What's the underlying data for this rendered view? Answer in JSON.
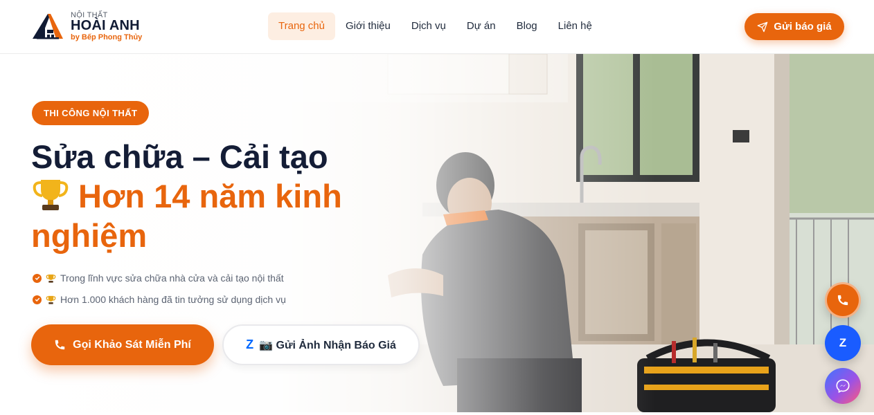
{
  "header": {
    "logo": {
      "small": "NỘI THẤT",
      "main": "HOÀI ANH",
      "sub": "by Bếp Phong Thủy"
    },
    "nav": [
      {
        "label": "Trang chủ",
        "active": true
      },
      {
        "label": "Giới thiệu",
        "active": false
      },
      {
        "label": "Dịch vụ",
        "active": false
      },
      {
        "label": "Dự án",
        "active": false
      },
      {
        "label": "Blog",
        "active": false
      },
      {
        "label": "Liên hệ",
        "active": false
      }
    ],
    "quote_button": {
      "label": "Gửi báo giá",
      "icon": "send-icon"
    }
  },
  "hero": {
    "badge": "THI CÔNG NỘI THẤT",
    "headline_line1": "Sửa chữa – Cải tạo",
    "headline_line2": "Hơn 14 năm kinh nghiệm",
    "headline_icon": "trophy-icon",
    "features": [
      {
        "text": "Trong lĩnh vực sửa chữa nhà cửa và cải tạo nội thất",
        "icon": "trophy-icon"
      },
      {
        "text": "Hơn 1.000 khách hàng đã tin tưởng sử dụng dịch vụ",
        "icon": "trophy-icon"
      }
    ],
    "cta_primary": {
      "label": "Gọi Khảo Sát Miễn Phí",
      "icon": "phone-icon"
    },
    "cta_secondary": {
      "label": "📷 Gửi Ảnh Nhận Báo Giá",
      "icon_text": "Z"
    }
  },
  "floating_buttons": {
    "phone_icon": "phone-icon",
    "zalo_label": "Z",
    "messenger_icon": "messenger-icon"
  },
  "colors": {
    "accent": "#e8650d",
    "navy": "#141d36",
    "zalo": "#1a5cff"
  }
}
